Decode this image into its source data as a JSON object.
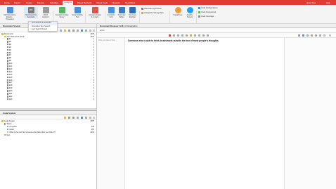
{
  "menubar": {
    "tabs": [
      "Home",
      "Import",
      "Codes",
      "Memos",
      "Variables",
      "Analysis",
      "Mixed Methods",
      "Visual Tools",
      "Reports",
      "TeamWork"
    ],
    "active_tab": "Analysis",
    "right_links": [
      "Quick Tips",
      "Help"
    ]
  },
  "ribbon": {
    "buttons": [
      {
        "label": "MAX Questions",
        "label2": "Experts · Thesaurus",
        "icon": "max-questions-icon"
      },
      {
        "label": "Text Search &",
        "label2": "Autocode",
        "icon": "text-search-icon"
      },
      {
        "label": "Word",
        "label2": "Explorer",
        "icon": "word-explorer-icon"
      },
      {
        "label": "Complex Coding",
        "label2": "Query",
        "icon": "complex-query-icon"
      },
      {
        "label": "Smart Coding",
        "label2": "Tool",
        "icon": "smart-coding-icon"
      },
      {
        "label": "Compare Cases",
        "label2": "& Groups",
        "icon": "compare-cases-icon"
      },
      {
        "label": "Summary",
        "label2": "Grid",
        "icon": "summary-grid-icon"
      },
      {
        "label": "Summary",
        "label2": "Tables",
        "icon": "summary-tables-icon"
      },
      {
        "label": "Summary",
        "label2": "Explorer",
        "icon": "summary-explorer-icon"
      },
      {
        "label": "Paraphrase",
        "label2": "",
        "icon": "paraphrase-icon"
      },
      {
        "label": "Analyze",
        "label2": "Tweets",
        "icon": "tweets-icon"
      }
    ],
    "small_buttons": [
      "Intercoder Agreement",
      "Categorize Survey Data",
      "Code Configurations",
      "Code Frequencies",
      "Code Coverage"
    ]
  },
  "dropdown": {
    "items": [
      "Text Search & Autocode",
      "Interactive Text Search",
      "Last Search Result"
    ]
  },
  "document_system": {
    "title": "Document System",
    "root": {
      "label": "Documents",
      "count": "4376"
    },
    "group": {
      "label": "New Document Group",
      "count": "4376"
    },
    "docs": [
      {
        "label": "E1",
        "count": "1"
      },
      {
        "label": "E2",
        "count": "1"
      },
      {
        "label": "E3",
        "count": "1"
      },
      {
        "label": "E4",
        "count": "1"
      },
      {
        "label": "E5",
        "count": "1"
      },
      {
        "label": "E6",
        "count": "1"
      },
      {
        "label": "E7",
        "count": "1"
      },
      {
        "label": "E8",
        "count": "1"
      },
      {
        "label": "E9",
        "count": "1"
      },
      {
        "label": "E10",
        "count": "1"
      },
      {
        "label": "E11",
        "count": "1"
      },
      {
        "label": "E12",
        "count": "1"
      },
      {
        "label": "E13",
        "count": "1"
      },
      {
        "label": "E14",
        "count": "1"
      },
      {
        "label": "E15",
        "count": "1"
      },
      {
        "label": "E16",
        "count": "1"
      },
      {
        "label": "E17",
        "count": "1"
      },
      {
        "label": "E18",
        "count": "1"
      },
      {
        "label": "E19",
        "count": "1"
      },
      {
        "label": "E20",
        "count": "1"
      },
      {
        "label": "E21",
        "count": "1"
      },
      {
        "label": "E22",
        "count": "1"
      },
      {
        "label": "E23",
        "count": "1"
      }
    ]
  },
  "code_system": {
    "title": "Code System",
    "root": {
      "label": "Code System",
      "count": "4378"
    },
    "codes": [
      {
        "label": "Topics",
        "count": "",
        "level": 1,
        "color": "#888888"
      },
      {
        "label": "your idea",
        "count": "132",
        "level": 2,
        "color": "#4a90d9"
      },
      {
        "label": "action",
        "count": "287",
        "level": 2,
        "color": "#4a90d9"
      },
      {
        "label": "What is the word for someone who thinks that you think of?",
        "count": "2243",
        "level": 2,
        "color": "#e6a23c"
      },
      {
        "label": "Sets",
        "count": "",
        "level": 1,
        "color": "#888888"
      }
    ]
  },
  "document_browser": {
    "title": "Document Browser: E18",
    "subtitle": "(1 Paragraphs)",
    "search_label": "action",
    "left_hint": "Write your idea to think",
    "text": "Someone who is able to think in abstracts outside the box of most people's thoughts."
  },
  "colors": {
    "brand": "#e33a34",
    "accent": "#f29a38"
  }
}
